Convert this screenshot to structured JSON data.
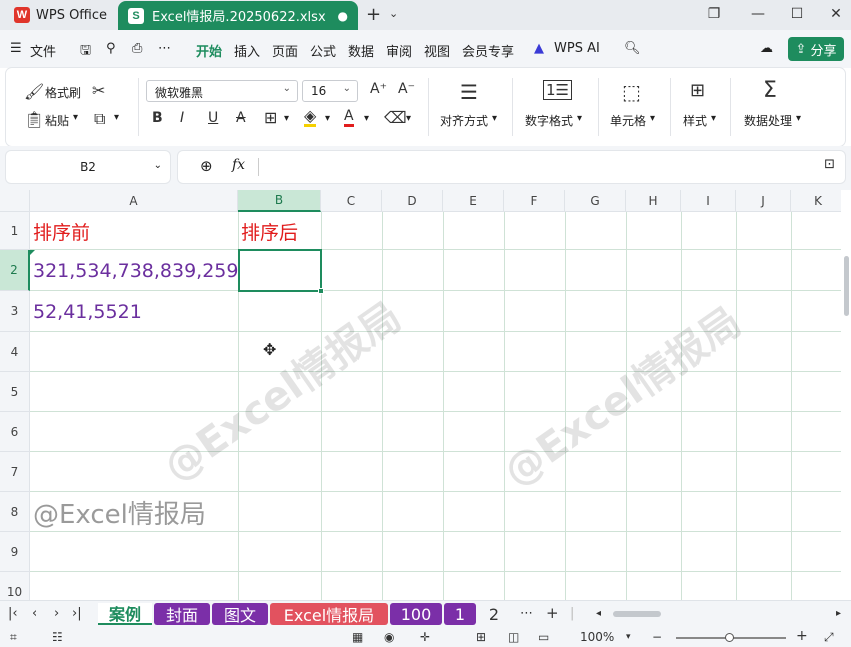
{
  "app": {
    "name": "WPS Office",
    "doc_tab": "Excel情报局.20250622.xlsx",
    "doc_dot": "●"
  },
  "titlebar_icons": {
    "plus": "+",
    "chevron": "⌄",
    "restore": "❐",
    "minimize": "—",
    "maximize": "☐",
    "close": "✕"
  },
  "menu": {
    "file": "文件",
    "items": [
      "开始",
      "插入",
      "页面",
      "公式",
      "数据",
      "审阅",
      "视图",
      "会员专享"
    ],
    "wps_ai": "WPS AI",
    "share": "分享"
  },
  "ribbon": {
    "format_painter": "格式刷",
    "paste": "粘贴",
    "font": "微软雅黑",
    "size": "16",
    "bold": "B",
    "italic": "I",
    "underline": "U",
    "strike": "A",
    "align": "对齐方式",
    "number_format": "数字格式",
    "cell": "单元格",
    "style": "样式",
    "data_process": "数据处理"
  },
  "formula_bar": {
    "name_box": "B2",
    "fx": "fx",
    "value": ""
  },
  "columns": [
    "A",
    "B",
    "C",
    "D",
    "E",
    "F",
    "G",
    "H",
    "I",
    "J",
    "K"
  ],
  "rows": [
    "1",
    "2",
    "3",
    "4",
    "5",
    "6",
    "7",
    "8",
    "9",
    "10"
  ],
  "cells": {
    "A1": "排序前",
    "B1": "排序后",
    "A2": "321,534,738,839,259",
    "A3": "52,41,5521",
    "A8": "@Excel情报局"
  },
  "watermark": "@Excel情报局",
  "sheets": [
    "案例",
    "封面",
    "图文",
    "Excel情报局",
    "100",
    "1",
    "2"
  ],
  "sheet_colors": {
    "封面": "#7b2fa8",
    "图文": "#7b2fa8",
    "Excel情报局": "#e2525f",
    "100": "#7b2fa8",
    "1": "#7b2fa8"
  },
  "status": {
    "zoom": "100%"
  },
  "colors": {
    "accent": "#1e8c5e",
    "red_text": "#e11d1d",
    "purple_text": "#6b2f9e"
  }
}
